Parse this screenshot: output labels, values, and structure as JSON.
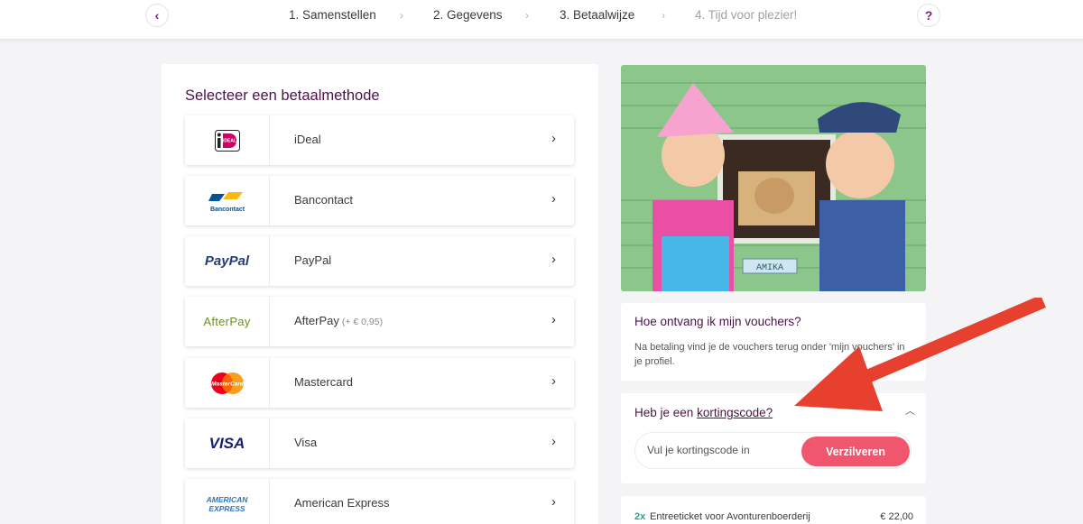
{
  "stepper": {
    "steps": [
      {
        "label": "1. Samenstellen",
        "state": "done"
      },
      {
        "label": "2. Gegevens",
        "state": "done"
      },
      {
        "label": "3. Betaalwijze",
        "state": "current"
      },
      {
        "label": "4. Tijd voor plezier!",
        "state": "future"
      }
    ],
    "help_label": "?",
    "back_label": "‹"
  },
  "payment": {
    "title": "Selecteer een betaalmethode",
    "methods": [
      {
        "label": "iDeal",
        "extra": "",
        "icon": "ideal-logo"
      },
      {
        "label": "Bancontact",
        "extra": "",
        "icon": "bancontact-logo"
      },
      {
        "label": "PayPal",
        "extra": "",
        "icon": "paypal-logo"
      },
      {
        "label": "AfterPay",
        "extra": "(+ € 0,95)",
        "icon": "afterpay-logo"
      },
      {
        "label": "Mastercard",
        "extra": "",
        "icon": "mastercard-logo"
      },
      {
        "label": "Visa",
        "extra": "",
        "icon": "visa-logo"
      },
      {
        "label": "American Express",
        "extra": "",
        "icon": "amex-logo"
      }
    ],
    "logo_text": {
      "ideal": "iDEAL",
      "bancontact": "Bancontact",
      "paypal": "PayPal",
      "afterpay": "AfterPay",
      "mastercard": "MasterCard",
      "visa": "VISA",
      "amex_line1": "AMERICAN",
      "amex_line2": "EXPRESS"
    }
  },
  "photo": {
    "sign_text": "AMIKA"
  },
  "vouchers": {
    "title": "Hoe ontvang ik mijn vouchers?",
    "text": "Na betaling vind je de vouchers terug onder 'mijn vouchers' in je profiel."
  },
  "discount": {
    "prefix": "Heb je een ",
    "link": "kortingscode?",
    "placeholder": "Vul je kortingscode in",
    "button": "Verzilveren"
  },
  "order": {
    "qty": "2x",
    "name": "Entreeticket voor Avonturenboerderij",
    "price": "€ 22,00"
  },
  "colors": {
    "accent": "#4b1449",
    "button": "#f0576f",
    "qty": "#2aa58a",
    "arrow": "#e8402f"
  }
}
